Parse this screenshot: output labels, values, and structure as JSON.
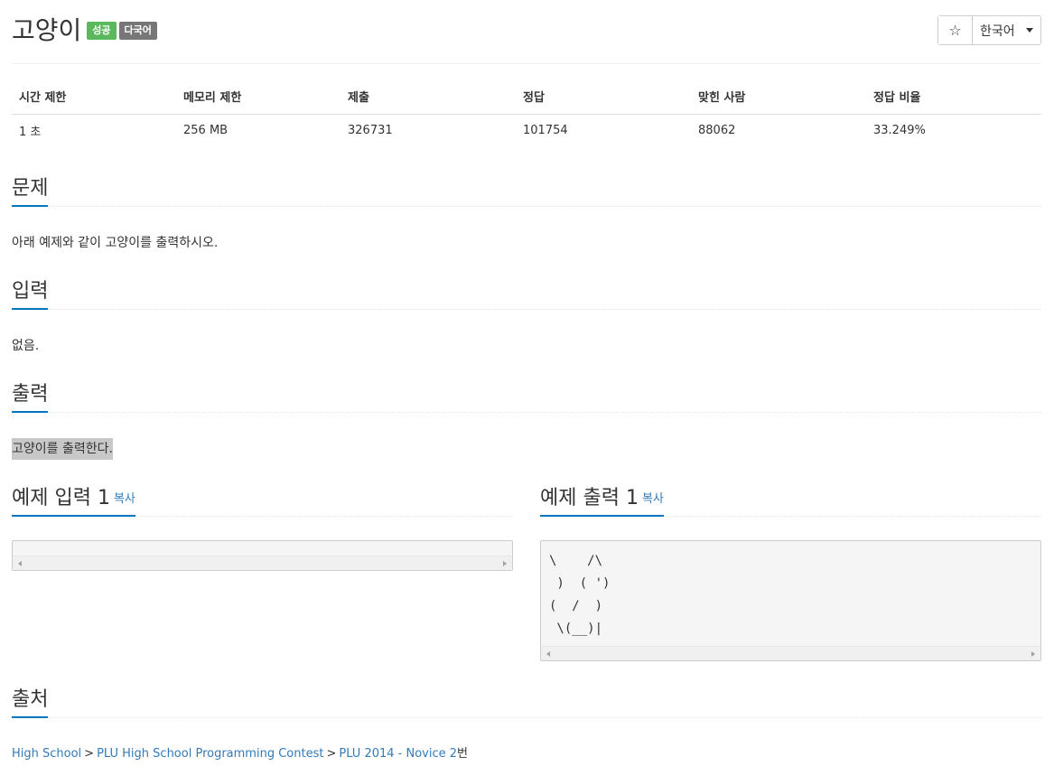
{
  "problem": {
    "title": "고양이",
    "badges": {
      "success": "성공",
      "multilang": "다국어"
    }
  },
  "header_controls": {
    "star_icon": "☆",
    "language": "한국어"
  },
  "stats": {
    "headers": [
      "시간 제한",
      "메모리 제한",
      "제출",
      "정답",
      "맞힌 사람",
      "정답 비율"
    ],
    "values": [
      "1 초",
      "256 MB",
      "326731",
      "101754",
      "88062",
      "33.249%"
    ]
  },
  "sections": {
    "description": {
      "heading": "문제",
      "text": "아래 예제와 같이 고양이를 출력하시오."
    },
    "input": {
      "heading": "입력",
      "text": "없음."
    },
    "output": {
      "heading": "출력",
      "text": "고양이를 출력한다."
    }
  },
  "samples": {
    "input": {
      "heading": "예제 입력 1",
      "copy": "복사",
      "content": ""
    },
    "output": {
      "heading": "예제 출력 1",
      "copy": "복사",
      "content": "\\    /\\\n )  ( ')\n(  /  )\n \\(__)|"
    }
  },
  "source": {
    "heading": "출처",
    "breadcrumb": [
      "High School",
      "PLU High School Programming Contest",
      "PLU 2014 - Novice 2"
    ],
    "separator": ">",
    "suffix": "번"
  }
}
